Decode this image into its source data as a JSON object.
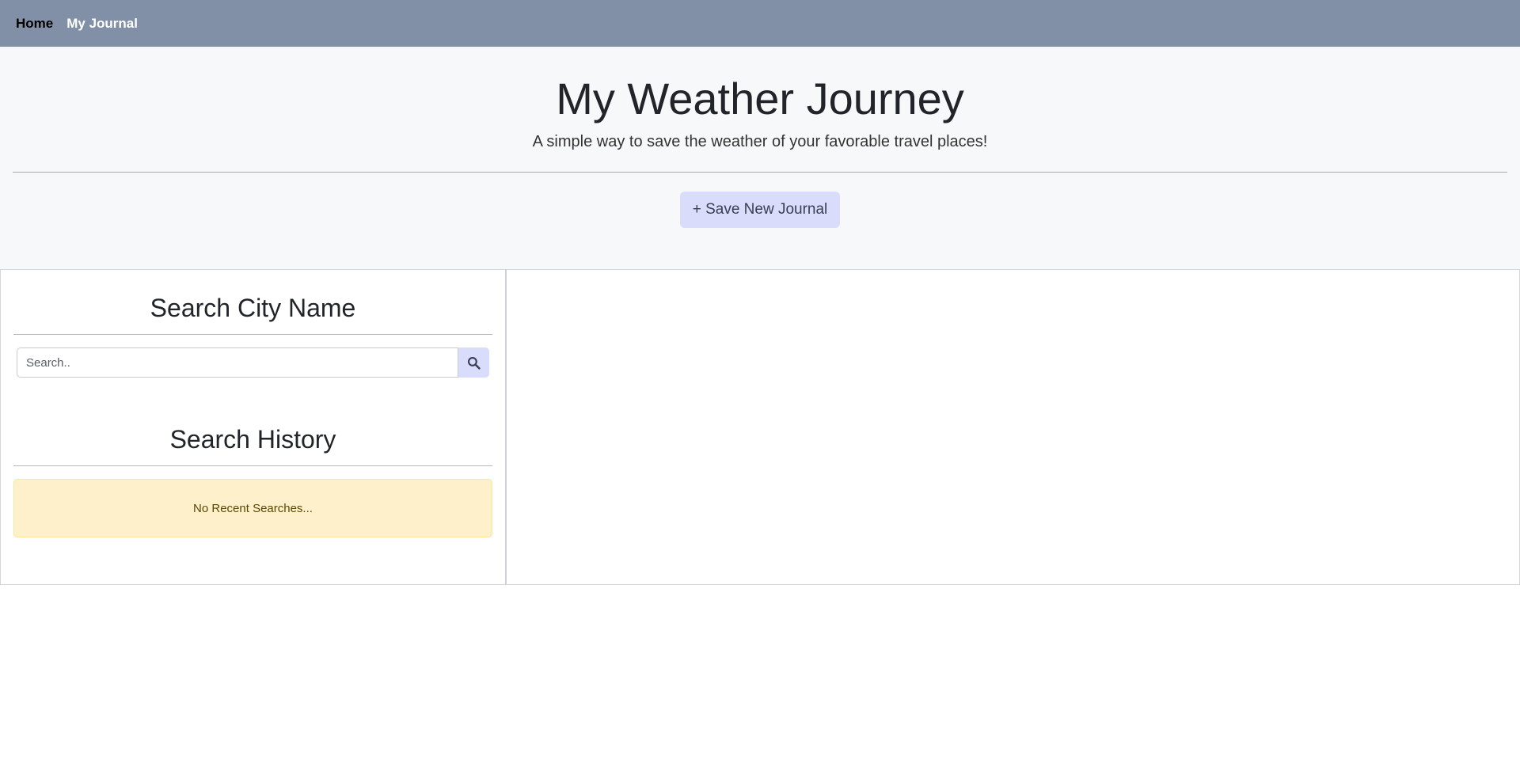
{
  "nav": {
    "items": [
      {
        "label": "Home",
        "active": true
      },
      {
        "label": "My Journal",
        "active": false
      }
    ]
  },
  "hero": {
    "title": "My Weather Journey",
    "subtitle": "A simple way to save the weather of your favorable travel places!",
    "save_button_label": "+ Save New Journal"
  },
  "search": {
    "title": "Search City Name",
    "placeholder": "Search..",
    "value": "",
    "button_icon": "search-icon"
  },
  "history": {
    "title": "Search History",
    "empty_message": "No Recent Searches..."
  },
  "colors": {
    "navbar_bg": "#8190a6",
    "hero_bg": "#f7f8f9",
    "button_bg": "#d9dcfb",
    "alert_bg": "#fff0cc"
  }
}
